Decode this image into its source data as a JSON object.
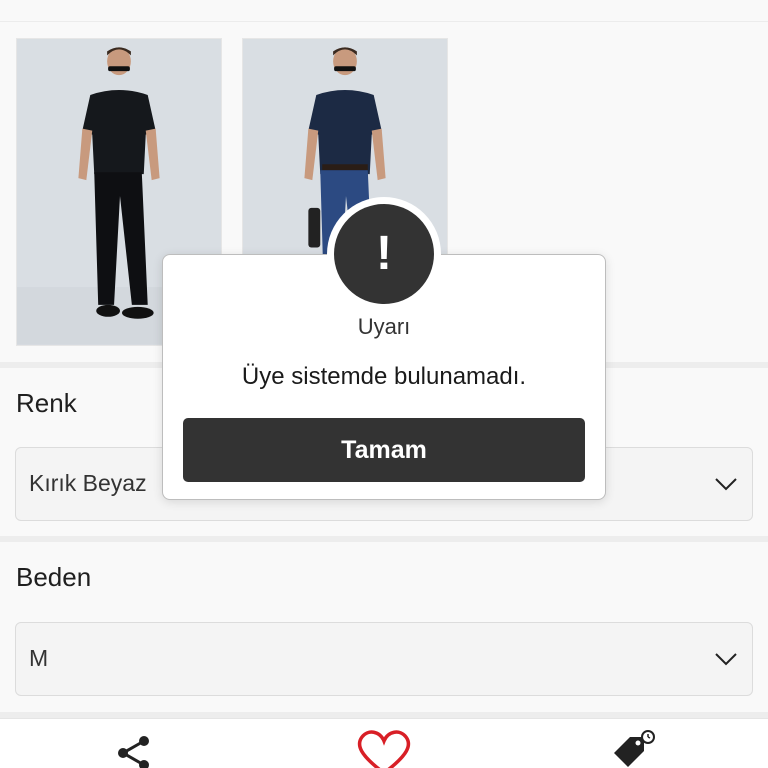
{
  "renk": {
    "title": "Renk",
    "selected": "Kırık Beyaz"
  },
  "beden": {
    "title": "Beden",
    "selected": "M"
  },
  "dialog": {
    "icon_symbol": "!",
    "title": "Uyarı",
    "message": "Üye sistemde bulunamadı.",
    "button_label": "Tamam"
  },
  "colors": {
    "dialog_button": "#333333",
    "favorite_heart": "#d81f26"
  },
  "icons": {
    "share": "share-icon",
    "favorite": "heart-icon",
    "price_alarm": "price-tag-alarm-icon",
    "dropdown": "chevron-down-icon"
  }
}
